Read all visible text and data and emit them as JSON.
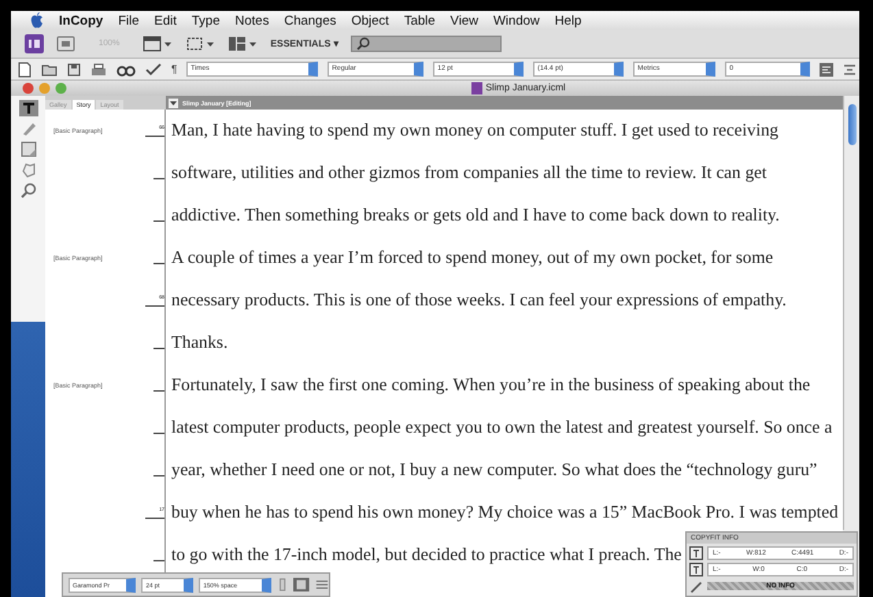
{
  "menu_bar": {
    "app": "InCopy",
    "items": [
      "File",
      "Edit",
      "Type",
      "Notes",
      "Changes",
      "Object",
      "Table",
      "View",
      "Window",
      "Help"
    ]
  },
  "app_bar": {
    "zoom": "100%",
    "workspace": "ESSENTIALS ▾"
  },
  "control_bar": {
    "font": "Times",
    "style": "Regular",
    "size": "12 pt",
    "leading": "(14.4 pt)",
    "kerning": "Metrics",
    "tracking": "0",
    "pilcrow": "¶"
  },
  "document": {
    "title": "Slimp January.icml",
    "tabs": [
      {
        "label": "Galley",
        "selected": false
      },
      {
        "label": "Story",
        "selected": true
      },
      {
        "label": "Layout",
        "selected": false
      }
    ],
    "story_header": "Slimp January [Editing]",
    "lines": [
      {
        "text": "Man, I hate having to spend my own money on computer stuff. I get used to receiving",
        "paragraph_style": "[Basic Paragraph]",
        "line_number": "66"
      },
      {
        "text": "software, utilities and other gizmos from companies all the time to review. It can get"
      },
      {
        "text": "addictive. Then something breaks or gets old and I have to come back down to reality."
      },
      {
        "text": "A couple of times a year I’m forced to spend money, out of my own pocket, for some",
        "paragraph_style": "[Basic Paragraph]"
      },
      {
        "text": "necessary products. This is one of those weeks. I can feel your expressions of empathy.",
        "line_number": "68"
      },
      {
        "text": "Thanks."
      },
      {
        "text": "Fortunately, I saw the first one coming. When you’re in the business of speaking about the",
        "paragraph_style": "[Basic Paragraph]"
      },
      {
        "text": "latest computer products, people expect you to own the latest and greatest yourself. So once a"
      },
      {
        "text": "year, whether I need one or not, I buy a new computer. So what does the “technology guru”"
      },
      {
        "text": "buy when he has to spend his own money? My choice was a 15” MacBook Pro. I was tempted",
        "line_number": "17"
      },
      {
        "text": "to go with the 17-inch model, but decided to practice what I preach. The"
      }
    ]
  },
  "text_toolbar": {
    "font": "Garamond Pr",
    "size": "24 pt",
    "spacing": "150% space"
  },
  "copyfit_panel": {
    "title": "COPYFIT INFO",
    "rows": [
      {
        "cells": [
          "L:-",
          "W:812",
          "C:4491",
          "D:-"
        ]
      },
      {
        "cells": [
          "L:-",
          "W:0",
          "C:0",
          "D:-"
        ]
      }
    ],
    "status": "NO INFO"
  }
}
